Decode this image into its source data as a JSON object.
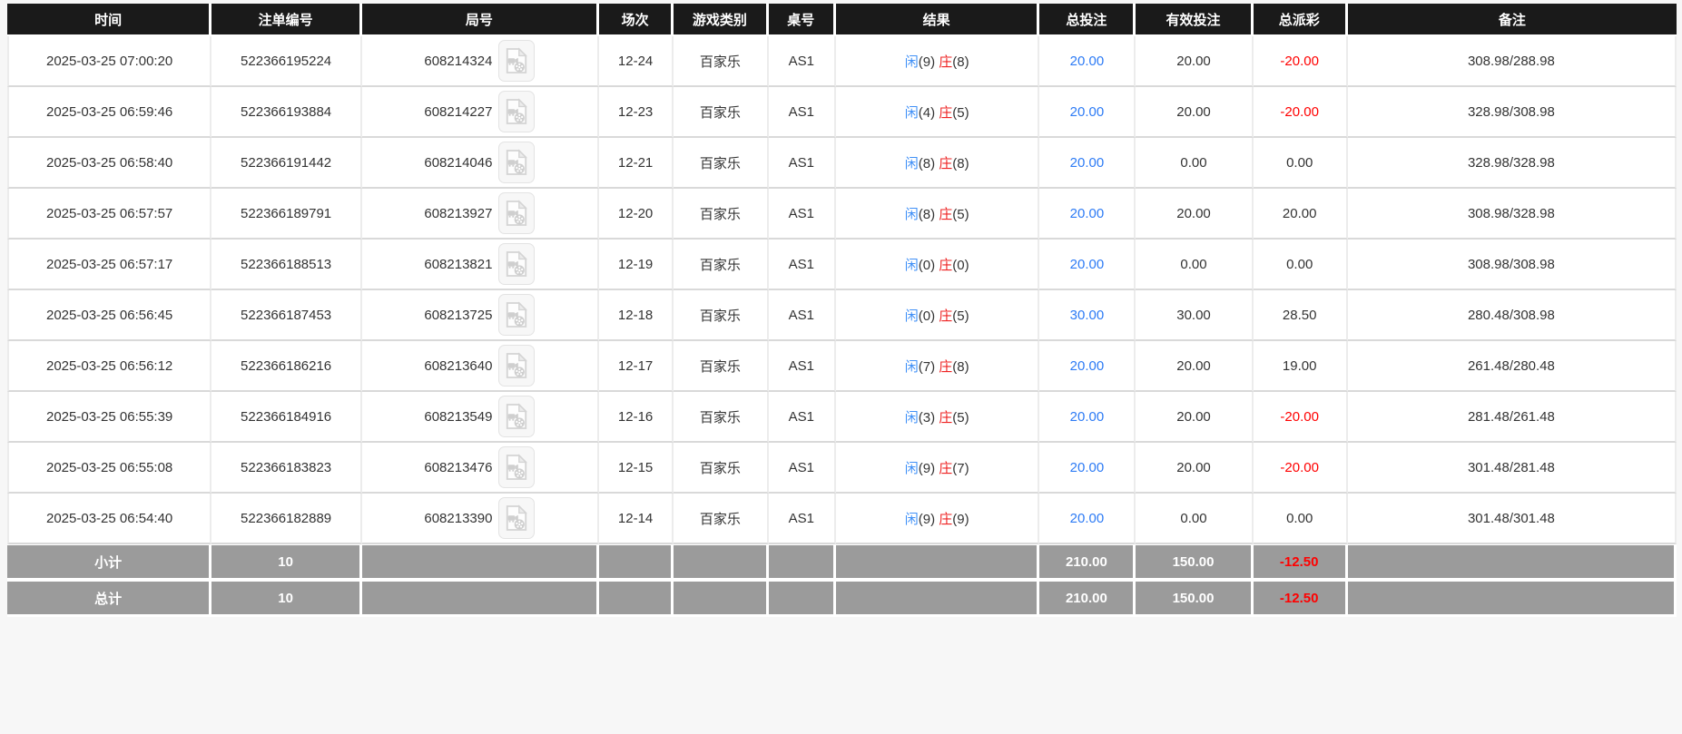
{
  "colors": {
    "header_bg": "#1a1a1a",
    "summary_bg": "#9b9b9b",
    "player_blue": "#4090f7",
    "banker_red": "#ee2222",
    "bet_blue": "#2d7bf5",
    "negative_red": "#ff0000"
  },
  "icons": {
    "round_video": "video-file-icon"
  },
  "table": {
    "columns": [
      {
        "key": "time",
        "label": "时间"
      },
      {
        "key": "bet_id",
        "label": "注单编号"
      },
      {
        "key": "round_id",
        "label": "局号"
      },
      {
        "key": "session",
        "label": "场次"
      },
      {
        "key": "game_type",
        "label": "游戏类别"
      },
      {
        "key": "table_no",
        "label": "桌号"
      },
      {
        "key": "result",
        "label": "结果"
      },
      {
        "key": "total_bet",
        "label": "总投注"
      },
      {
        "key": "valid_bet",
        "label": "有效投注"
      },
      {
        "key": "total_payout",
        "label": "总派彩"
      },
      {
        "key": "remark",
        "label": "备注"
      }
    ],
    "rows": [
      {
        "time": "2025-03-25 07:00:20",
        "bet_id": "522366195224",
        "round_id": "608214324",
        "session": "12-24",
        "game_type": "百家乐",
        "table_no": "AS1",
        "result": {
          "player": "闲",
          "player_pts": "(9)",
          "banker": "庄",
          "banker_pts": "(8)"
        },
        "total_bet": "20.00",
        "valid_bet": "20.00",
        "total_payout": "-20.00",
        "remark": "308.98/288.98"
      },
      {
        "time": "2025-03-25 06:59:46",
        "bet_id": "522366193884",
        "round_id": "608214227",
        "session": "12-23",
        "game_type": "百家乐",
        "table_no": "AS1",
        "result": {
          "player": "闲",
          "player_pts": "(4)",
          "banker": "庄",
          "banker_pts": "(5)"
        },
        "total_bet": "20.00",
        "valid_bet": "20.00",
        "total_payout": "-20.00",
        "remark": "328.98/308.98"
      },
      {
        "time": "2025-03-25 06:58:40",
        "bet_id": "522366191442",
        "round_id": "608214046",
        "session": "12-21",
        "game_type": "百家乐",
        "table_no": "AS1",
        "result": {
          "player": "闲",
          "player_pts": "(8)",
          "banker": "庄",
          "banker_pts": "(8)"
        },
        "total_bet": "20.00",
        "valid_bet": "0.00",
        "total_payout": "0.00",
        "remark": "328.98/328.98"
      },
      {
        "time": "2025-03-25 06:57:57",
        "bet_id": "522366189791",
        "round_id": "608213927",
        "session": "12-20",
        "game_type": "百家乐",
        "table_no": "AS1",
        "result": {
          "player": "闲",
          "player_pts": "(8)",
          "banker": "庄",
          "banker_pts": "(5)"
        },
        "total_bet": "20.00",
        "valid_bet": "20.00",
        "total_payout": "20.00",
        "remark": "308.98/328.98"
      },
      {
        "time": "2025-03-25 06:57:17",
        "bet_id": "522366188513",
        "round_id": "608213821",
        "session": "12-19",
        "game_type": "百家乐",
        "table_no": "AS1",
        "result": {
          "player": "闲",
          "player_pts": "(0)",
          "banker": "庄",
          "banker_pts": "(0)"
        },
        "total_bet": "20.00",
        "valid_bet": "0.00",
        "total_payout": "0.00",
        "remark": "308.98/308.98"
      },
      {
        "time": "2025-03-25 06:56:45",
        "bet_id": "522366187453",
        "round_id": "608213725",
        "session": "12-18",
        "game_type": "百家乐",
        "table_no": "AS1",
        "result": {
          "player": "闲",
          "player_pts": "(0)",
          "banker": "庄",
          "banker_pts": "(5)"
        },
        "total_bet": "30.00",
        "valid_bet": "30.00",
        "total_payout": "28.50",
        "remark": "280.48/308.98"
      },
      {
        "time": "2025-03-25 06:56:12",
        "bet_id": "522366186216",
        "round_id": "608213640",
        "session": "12-17",
        "game_type": "百家乐",
        "table_no": "AS1",
        "result": {
          "player": "闲",
          "player_pts": "(7)",
          "banker": "庄",
          "banker_pts": "(8)"
        },
        "total_bet": "20.00",
        "valid_bet": "20.00",
        "total_payout": "19.00",
        "remark": "261.48/280.48"
      },
      {
        "time": "2025-03-25 06:55:39",
        "bet_id": "522366184916",
        "round_id": "608213549",
        "session": "12-16",
        "game_type": "百家乐",
        "table_no": "AS1",
        "result": {
          "player": "闲",
          "player_pts": "(3)",
          "banker": "庄",
          "banker_pts": "(5)"
        },
        "total_bet": "20.00",
        "valid_bet": "20.00",
        "total_payout": "-20.00",
        "remark": "281.48/261.48"
      },
      {
        "time": "2025-03-25 06:55:08",
        "bet_id": "522366183823",
        "round_id": "608213476",
        "session": "12-15",
        "game_type": "百家乐",
        "table_no": "AS1",
        "result": {
          "player": "闲",
          "player_pts": "(9)",
          "banker": "庄",
          "banker_pts": "(7)"
        },
        "total_bet": "20.00",
        "valid_bet": "20.00",
        "total_payout": "-20.00",
        "remark": "301.48/281.48"
      },
      {
        "time": "2025-03-25 06:54:40",
        "bet_id": "522366182889",
        "round_id": "608213390",
        "session": "12-14",
        "game_type": "百家乐",
        "table_no": "AS1",
        "result": {
          "player": "闲",
          "player_pts": "(9)",
          "banker": "庄",
          "banker_pts": "(9)"
        },
        "total_bet": "20.00",
        "valid_bet": "0.00",
        "total_payout": "0.00",
        "remark": "301.48/301.48"
      }
    ],
    "summary_rows": [
      {
        "label": "小计",
        "count": "10",
        "total_bet": "210.00",
        "valid_bet": "150.00",
        "total_payout": "-12.50"
      },
      {
        "label": "总计",
        "count": "10",
        "total_bet": "210.00",
        "valid_bet": "150.00",
        "total_payout": "-12.50"
      }
    ]
  }
}
